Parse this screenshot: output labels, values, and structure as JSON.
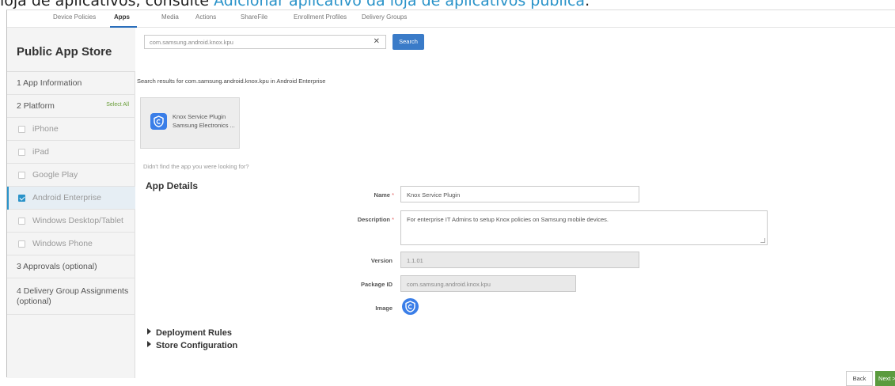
{
  "caption": {
    "prefix": "loja de aplicativos, consulte ",
    "link": "Adicionar aplicativo da loja de aplicativos pública",
    "suffix": "."
  },
  "tabs": [
    "Device Policies",
    "Apps",
    "Media",
    "Actions",
    "ShareFile",
    "Enrollment Profiles",
    "Delivery Groups"
  ],
  "active_tab": "Apps",
  "sidebar": {
    "title": "Public App Store",
    "step1": "1  App Information",
    "step2": "2  Platform",
    "select_all": "Select All",
    "platforms": [
      {
        "label": "iPhone",
        "checked": false
      },
      {
        "label": "iPad",
        "checked": false
      },
      {
        "label": "Google Play",
        "checked": false
      },
      {
        "label": "Android Enterprise",
        "checked": true
      },
      {
        "label": "Windows Desktop/Tablet",
        "checked": false
      },
      {
        "label": "Windows Phone",
        "checked": false
      }
    ],
    "step3": "3  Approvals (optional)",
    "step4": "4  Delivery Group Assignments (optional)"
  },
  "search": {
    "value": "com.samsung.android.knox.kpu",
    "clear": "✕",
    "button": "Search",
    "results_text": "Search results for com.samsung.android.knox.kpu in Android Enterprise"
  },
  "result_card": {
    "name": "Knox Service Plugin",
    "vendor": "Samsung Electronics ..."
  },
  "didnt_find": "Didn't find the app you were looking for?",
  "app_details": {
    "title": "App Details",
    "name_label": "Name",
    "name_value": "Knox Service Plugin",
    "description_label": "Description",
    "description_value": "For enterprise IT Admins to setup Knox policies on Samsung mobile devices.",
    "version_label": "Version",
    "version_value": "1.1.01",
    "package_label": "Package ID",
    "package_value": "com.samsung.android.knox.kpu",
    "image_label": "Image",
    "required_mark": "*"
  },
  "sections": {
    "deployment_rules": "Deployment Rules",
    "store_configuration": "Store Configuration"
  },
  "footer": {
    "back": "Back",
    "next": "Next >"
  },
  "colors": {
    "accent": "#2a93c9",
    "search_button": "#3a7bc8",
    "next_button": "#5b9b3e",
    "select_all": "#6a9e3a"
  }
}
